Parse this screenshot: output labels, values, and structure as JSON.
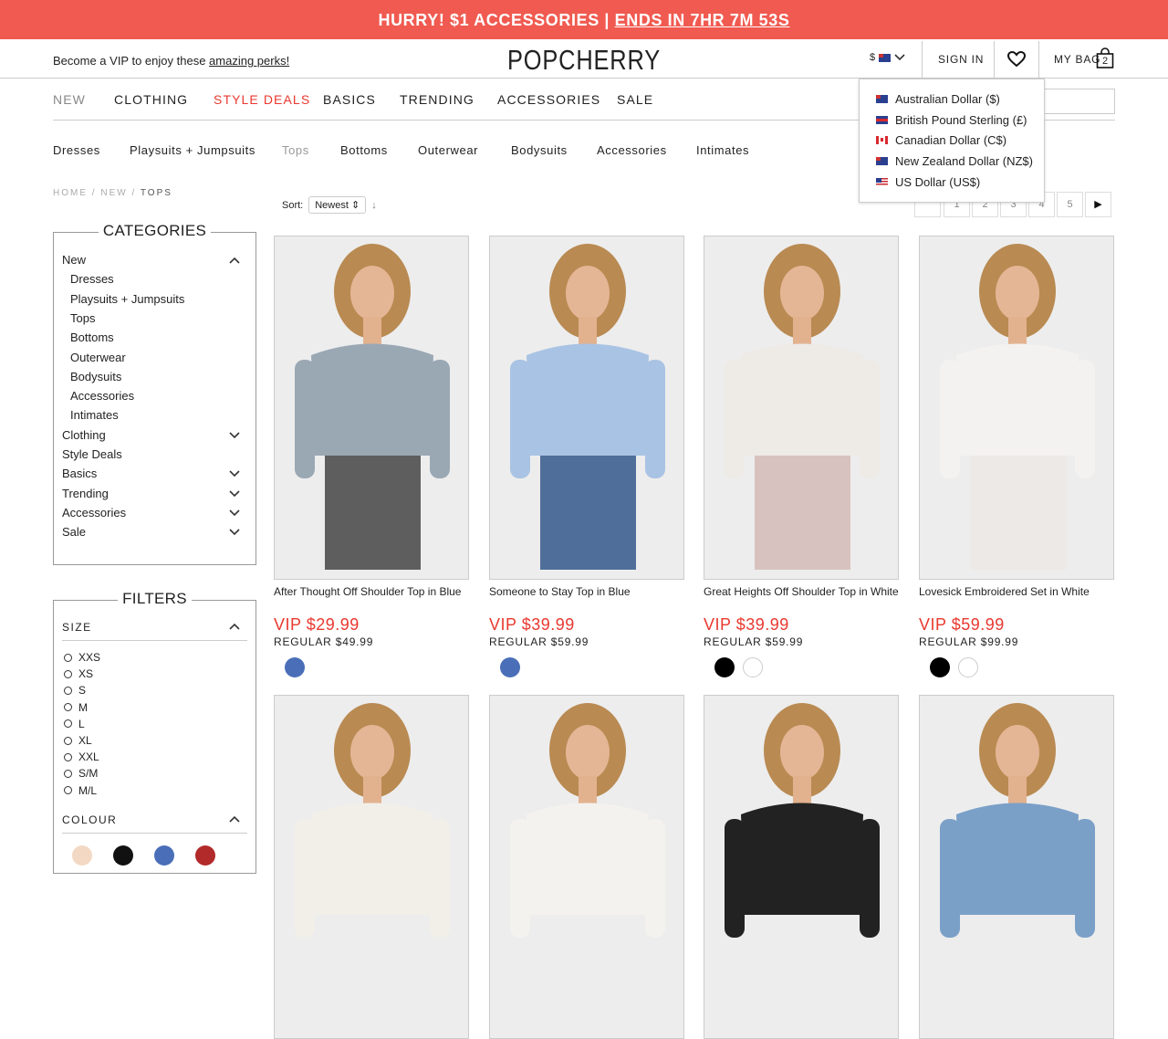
{
  "promo": {
    "text": "HURRY! $1 ACCESSORIES | ",
    "link": "ENDS IN 7HR 7M 53S"
  },
  "topbar": {
    "vip_text": "Become a VIP to enjoy these ",
    "vip_link": "amazing perks!",
    "logo": "POPCHERRY",
    "currency_symbol": "$",
    "sign_in": "SIGN IN",
    "bag_label": "MY BAG",
    "bag_count": "2"
  },
  "currency_menu": [
    {
      "label": "Australian Dollar ($)",
      "flag": "au"
    },
    {
      "label": "British Pound Sterling (£)",
      "flag": "uk"
    },
    {
      "label": "Canadian Dollar (C$)",
      "flag": "ca"
    },
    {
      "label": "New Zealand Dollar (NZ$)",
      "flag": "au"
    },
    {
      "label": "US Dollar (US$)",
      "flag": "us"
    }
  ],
  "main_nav": [
    "NEW",
    "CLOTHING",
    "STYLE DEALS",
    "BASICS",
    "TRENDING",
    "ACCESSORIES",
    "SALE"
  ],
  "sub_nav": [
    "Dresses",
    "Playsuits + Jumpsuits",
    "Tops",
    "Bottoms",
    "Outerwear",
    "Bodysuits",
    "Accessories",
    "Intimates"
  ],
  "breadcrumb": {
    "a": "HOME",
    "b": "NEW",
    "c": "TOPS",
    "sep": "/"
  },
  "sort": {
    "label": "Sort:",
    "value": "Newest"
  },
  "pagination": [
    "1",
    "2",
    "3",
    "4",
    "5"
  ],
  "categories": {
    "title": "CATEGORIES",
    "items": [
      {
        "label": "New",
        "level": 0,
        "chev": "up"
      },
      {
        "label": "Dresses",
        "level": 1
      },
      {
        "label": "Playsuits + Jumpsuits",
        "level": 1
      },
      {
        "label": "Tops",
        "level": 1
      },
      {
        "label": "Bottoms",
        "level": 1
      },
      {
        "label": "Outerwear",
        "level": 1
      },
      {
        "label": "Bodysuits",
        "level": 1
      },
      {
        "label": "Accessories",
        "level": 1
      },
      {
        "label": "Intimates",
        "level": 1
      },
      {
        "label": "Clothing",
        "level": 0,
        "chev": "down"
      },
      {
        "label": "Style Deals",
        "level": 0
      },
      {
        "label": "Basics",
        "level": 0,
        "chev": "down"
      },
      {
        "label": "Trending",
        "level": 0,
        "chev": "down"
      },
      {
        "label": "Accessories",
        "level": 0,
        "chev": "down"
      },
      {
        "label": "Sale",
        "level": 0,
        "chev": "down"
      }
    ]
  },
  "filters": {
    "title": "FILTERS",
    "size_label": "SIZE",
    "sizes": [
      "XXS",
      "XS",
      "S",
      "M",
      "L",
      "XL",
      "XXL",
      "S/M",
      "M/L"
    ],
    "colour_label": "COLOUR",
    "colours": [
      "#f3d9c4",
      "#111111",
      "#4a6fb8",
      "#b22a2a"
    ]
  },
  "products": [
    {
      "name": "After Thought Off Shoulder Top in Blue",
      "vip": "VIP $29.99",
      "regular": "REGULAR $49.99",
      "swatches": [
        "#4a6fb8"
      ],
      "top": "#9aa8b4",
      "bottom": "#5e5e5e"
    },
    {
      "name": "Someone to Stay Top in Blue",
      "vip": "VIP $39.99",
      "regular": "REGULAR $59.99",
      "swatches": [
        "#4a6fb8"
      ],
      "top": "#a9c3e4",
      "bottom": "#4f6f9a"
    },
    {
      "name": "Great Heights Off Shoulder Top in White",
      "vip": "VIP $39.99",
      "regular": "REGULAR $59.99",
      "swatches": [
        "#000000",
        "#ffffff"
      ],
      "top": "#eeeae6",
      "bottom": "#d8c2bf"
    },
    {
      "name": "Lovesick Embroidered Set in White",
      "vip": "VIP $59.99",
      "regular": "REGULAR $99.99",
      "swatches": [
        "#000000",
        "#ffffff"
      ],
      "top": "#f4f2f0",
      "bottom": "#ece9e6"
    },
    {
      "name": "",
      "vip": "",
      "regular": "",
      "swatches": [],
      "top": "#f2efe9",
      "bottom": ""
    },
    {
      "name": "",
      "vip": "",
      "regular": "",
      "swatches": [],
      "top": "#f4f2ee",
      "bottom": ""
    },
    {
      "name": "",
      "vip": "",
      "regular": "",
      "swatches": [],
      "top": "#222222",
      "bottom": ""
    },
    {
      "name": "",
      "vip": "",
      "regular": "",
      "swatches": [],
      "top": "#7aa0c8",
      "bottom": ""
    }
  ]
}
